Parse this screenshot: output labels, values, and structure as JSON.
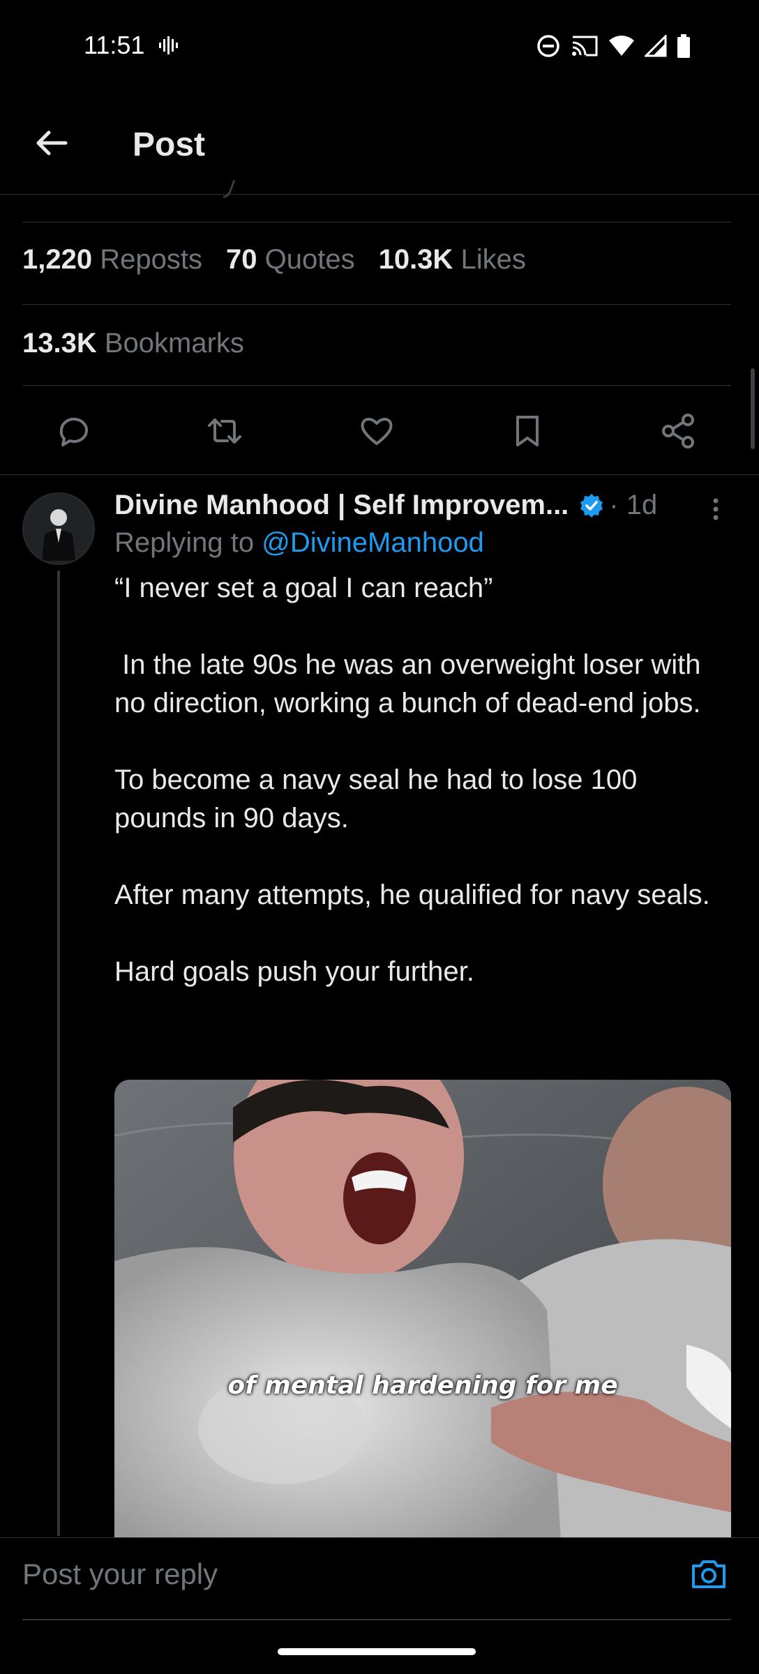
{
  "status_bar": {
    "time": "11:51"
  },
  "header": {
    "title": "Post"
  },
  "stats": {
    "reposts_count": "1,220",
    "reposts_label": "Reposts",
    "quotes_count": "70",
    "quotes_label": "Quotes",
    "likes_count": "10.3K",
    "likes_label": "Likes",
    "bookmarks_count": "13.3K",
    "bookmarks_label": "Bookmarks"
  },
  "actions": [
    "reply-icon",
    "repost-icon",
    "like-icon",
    "bookmark-icon",
    "share-icon"
  ],
  "reply": {
    "author": "Divine Manhood | Self Improvem...",
    "verified": true,
    "time": "· 1d",
    "replying_prefix": "Replying to",
    "replying_handle": "@DivineManhood",
    "paragraphs": [
      "“I never set a goal I can reach”",
      " In the late 90s he was an overweight loser with no direction, working a bunch of dead-end jobs.",
      "To become a navy seal he had to lose 100 pounds in 90 days.",
      "After many attempts, he qualified for navy seals.",
      "Hard goals push your further."
    ],
    "media_caption": "of mental hardening for me"
  },
  "composer": {
    "placeholder": "Post your reply"
  },
  "colors": {
    "accent": "#1d9bf0",
    "muted": "#71767b",
    "text": "#e7e9ea",
    "divider": "#2f3336"
  }
}
